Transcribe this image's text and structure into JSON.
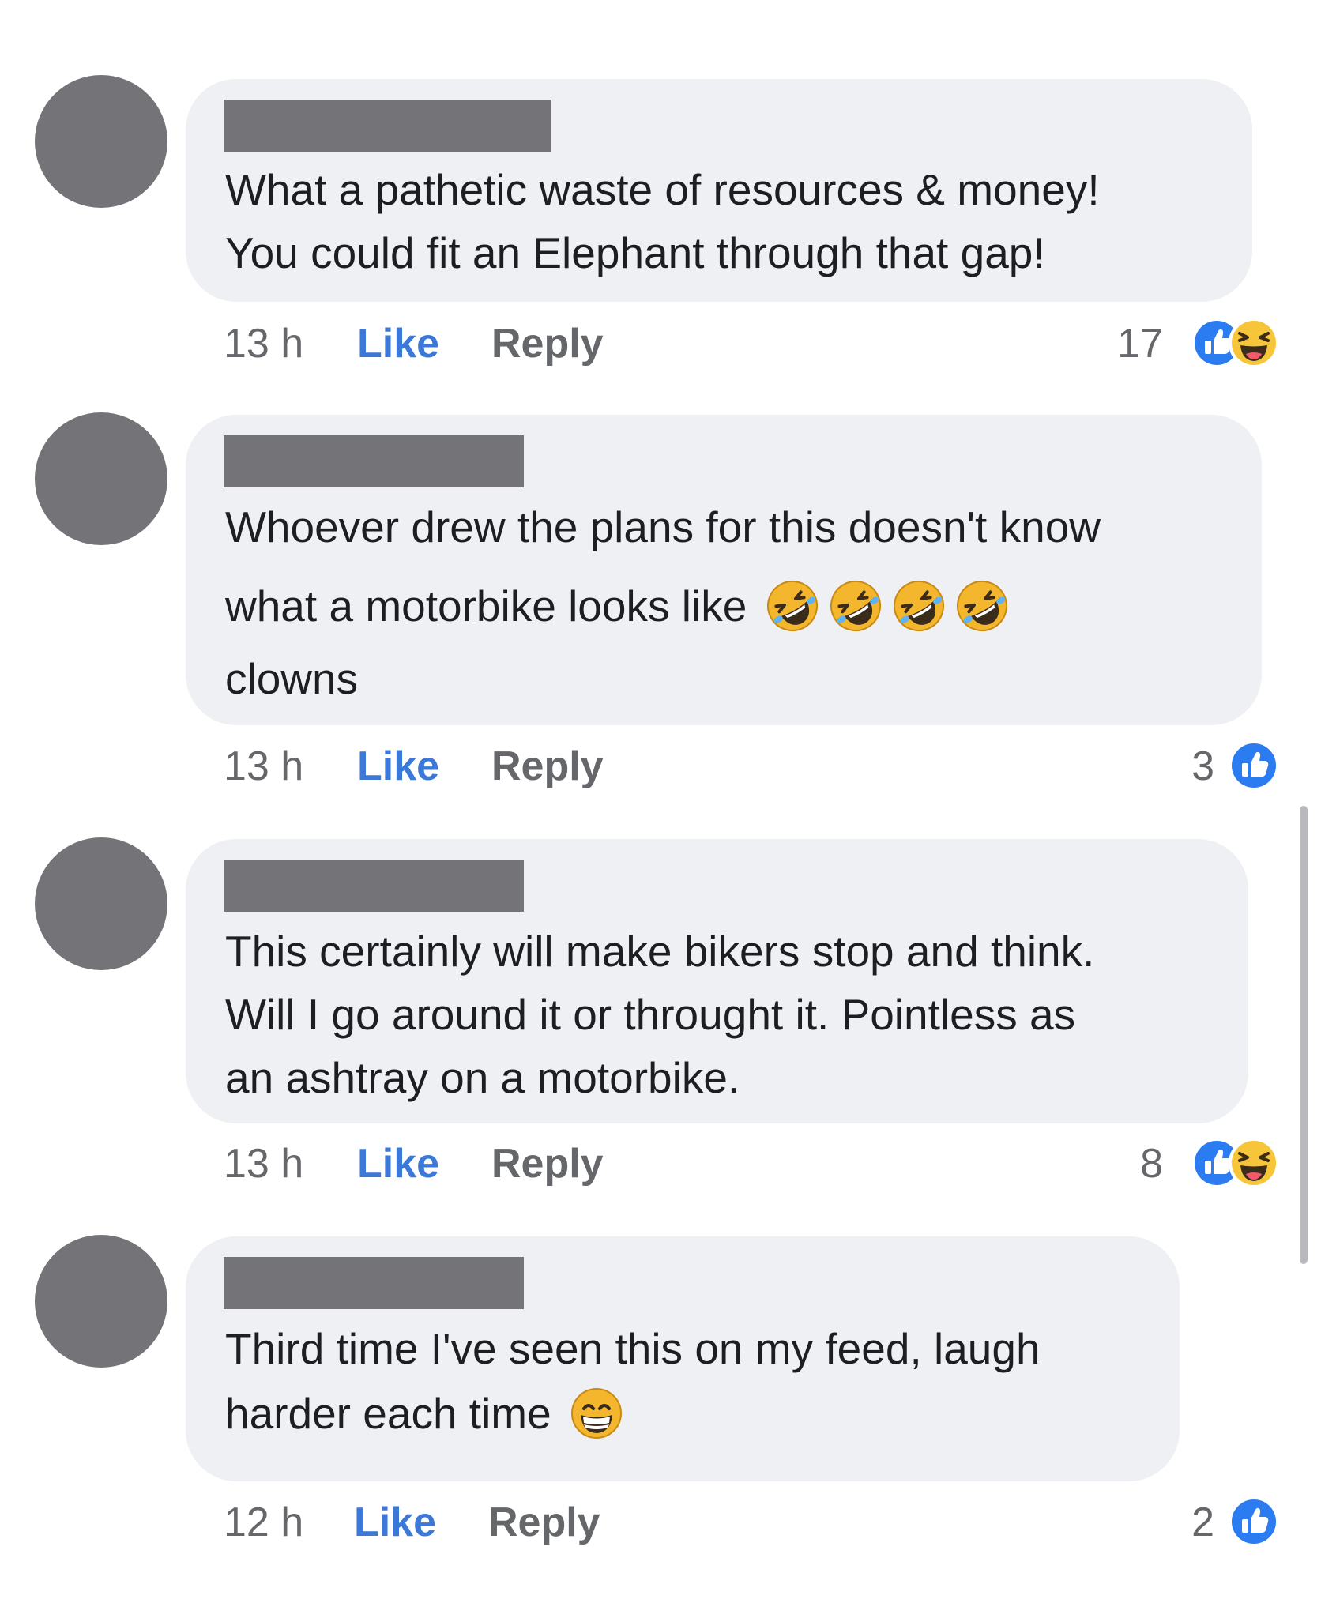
{
  "comments": [
    {
      "lines": [
        "What a pathetic waste of resources & money!",
        "You could fit an Elephant through that gap!"
      ],
      "time": "13 h",
      "like": "Like",
      "reply": "Reply",
      "reaction_count": "17",
      "reactions": [
        "like-icon",
        "laugh-icon"
      ]
    },
    {
      "lines": [
        "Whoever drew the plans for this doesn't know",
        "what a motorbike looks like",
        "clowns"
      ],
      "line_emojis": [
        "rolling-on-floor-laughing-emoji",
        "rolling-on-floor-laughing-emoji",
        "rolling-on-floor-laughing-emoji",
        "rolling-on-floor-laughing-emoji"
      ],
      "time": "13 h",
      "like": "Like",
      "reply": "Reply",
      "reaction_count": "3",
      "reactions": [
        "like-icon"
      ]
    },
    {
      "lines": [
        "This certainly will make bikers stop and think.",
        "Will I go around it or throught it. Pointless as",
        "an ashtray on a motorbike."
      ],
      "time": "13 h",
      "like": "Like",
      "reply": "Reply",
      "reaction_count": "8",
      "reactions": [
        "like-icon",
        "laugh-icon"
      ]
    },
    {
      "lines": [
        "Third time I've seen this on my feed, laugh",
        "harder each time"
      ],
      "line_emojis": [
        "grinning-face-emoji"
      ],
      "time": "12 h",
      "like": "Like",
      "reply": "Reply",
      "reaction_count": "2",
      "reactions": [
        "like-icon"
      ]
    }
  ],
  "colors": {
    "bubble": "#eff0f4",
    "avatar_redacted": "#737378",
    "like_blue": "#3b78d8",
    "meta_gray": "#65676b"
  }
}
